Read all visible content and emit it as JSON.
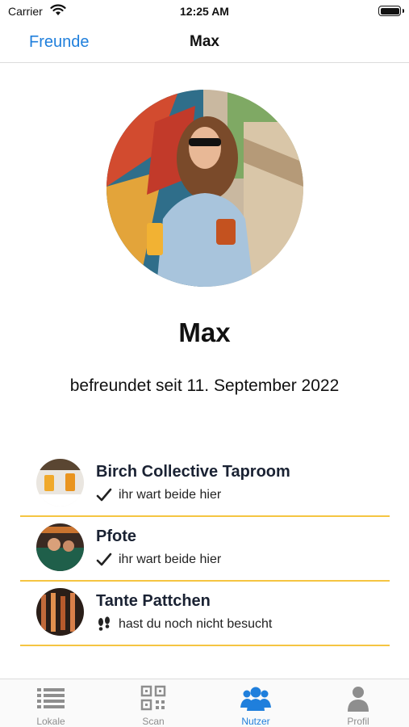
{
  "status_bar": {
    "carrier": "Carrier",
    "time": "12:25 AM"
  },
  "nav": {
    "back_label": "Freunde",
    "title": "Max"
  },
  "profile": {
    "name": "Max",
    "friends_since": "befreundet seit 11. September 2022"
  },
  "venues": [
    {
      "name": "Birch Collective Taproom",
      "status": "ihr wart beide hier",
      "status_icon": "checkmark-icon"
    },
    {
      "name": "Pfote",
      "status": "ihr wart beide hier",
      "status_icon": "checkmark-icon"
    },
    {
      "name": "Tante Pattchen",
      "status": "hast du noch nicht besucht",
      "status_icon": "footprints-icon"
    }
  ],
  "tabs": [
    {
      "label": "Lokale",
      "icon": "list-icon",
      "active": false
    },
    {
      "label": "Scan",
      "icon": "qr-code-icon",
      "active": false
    },
    {
      "label": "Nutzer",
      "icon": "users-icon",
      "active": true
    },
    {
      "label": "Profil",
      "icon": "person-icon",
      "active": false
    }
  ],
  "colors": {
    "accent": "#1f7fdc",
    "divider": "#f5c542",
    "inactive": "#8e8e8e"
  }
}
